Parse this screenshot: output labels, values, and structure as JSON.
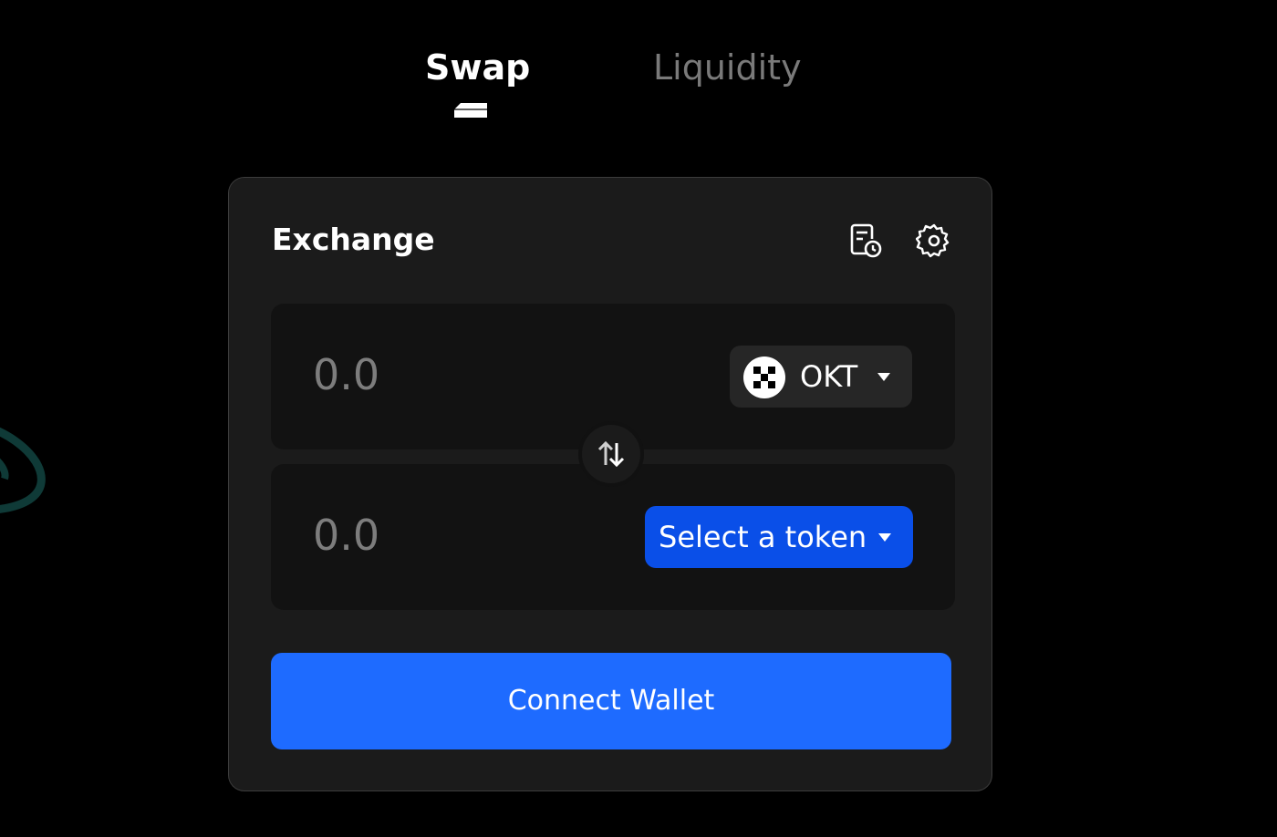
{
  "tabs": [
    {
      "label": "Swap",
      "active": true
    },
    {
      "label": "Liquidity",
      "active": false
    }
  ],
  "exchange": {
    "title": "Exchange",
    "icons": {
      "history": "history-icon",
      "settings": "gear-icon"
    },
    "from": {
      "amount_placeholder": "0.0",
      "token": "OKT",
      "token_icon": "okt-logo-icon"
    },
    "swap_direction_icon": "swap-arrows-icon",
    "to": {
      "amount_placeholder": "0.0",
      "select_label": "Select a token"
    },
    "connect_label": "Connect Wallet"
  },
  "colors": {
    "background": "#000000",
    "card": "#1b1b1b",
    "input_box": "#121212",
    "accent_blue": "#1e6bff",
    "select_blue": "#0a4fe8",
    "inactive_text": "#7a7a7a"
  }
}
